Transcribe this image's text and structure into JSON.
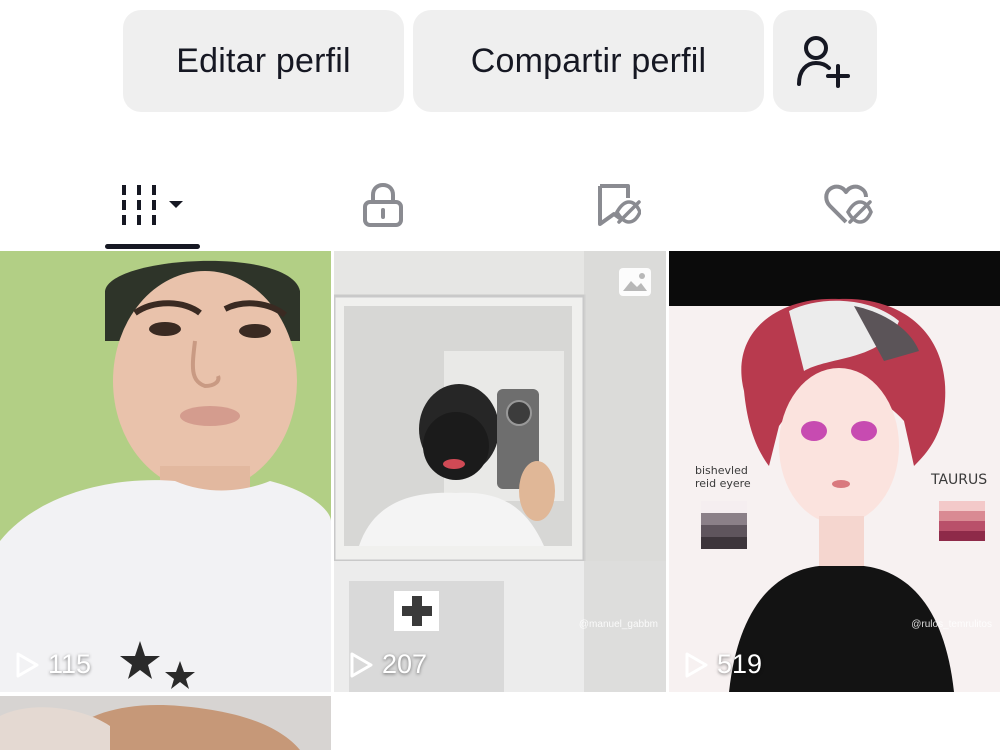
{
  "actions": {
    "edit_profile": "Editar perfil",
    "share_profile": "Compartir perfil",
    "add_friend_icon": "person-add-icon"
  },
  "tabs": [
    {
      "icon": "grid-icon",
      "active": true,
      "has_dropdown": true
    },
    {
      "icon": "lock-icon",
      "active": false
    },
    {
      "icon": "bookmark-hidden-icon",
      "active": false
    },
    {
      "icon": "heart-hidden-icon",
      "active": false
    }
  ],
  "videos": [
    {
      "views": "115"
    },
    {
      "views": "207",
      "watermark": "@manuel_gabbm",
      "photo_badge": true
    },
    {
      "views": "519",
      "watermark": "@rulos_temrulitos",
      "art_text_left": "bishevled reid eyere",
      "art_text_right": "TAURUS"
    },
    {
      "views": ""
    }
  ],
  "colors": {
    "button_bg": "#efefef",
    "text": "#161823",
    "icon_gray": "#8a8b91"
  }
}
